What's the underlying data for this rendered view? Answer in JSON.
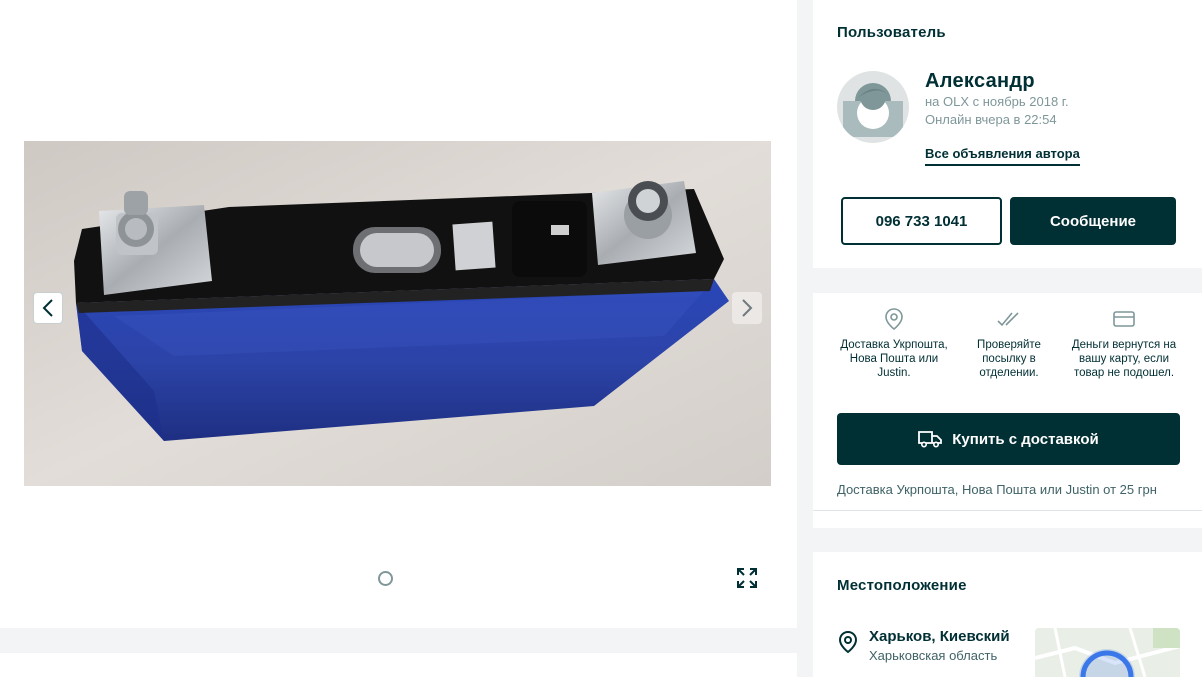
{
  "gallery": {
    "image_alt": "LiFePO4 battery cell",
    "slide_count": 1
  },
  "user": {
    "heading": "Пользователь",
    "name": "Александр",
    "since": "на OLX с ноябрь 2018 г.",
    "online": "Онлайн вчера в 22:54",
    "all_ads": "Все объявления автора",
    "phone": "096 733 1041",
    "message": "Сообщение"
  },
  "delivery": {
    "features": [
      {
        "icon": "location-pin-icon",
        "text": "Доставка Укрпошта, Нова Пошта или Justin."
      },
      {
        "icon": "double-check-icon",
        "text": "Проверяйте посылку в отделении."
      },
      {
        "icon": "credit-card-icon",
        "text": "Деньги вернутся на вашу карту, если товар не подошел."
      }
    ],
    "buy_label": "Купить с доставкой",
    "note": "Доставка Укрпошта, Нова Пошта или Justin от 25 грн"
  },
  "location": {
    "heading": "Местоположение",
    "city": "Харьков, Киевский",
    "region": "Харьковская область"
  },
  "colors": {
    "primary": "#002f34",
    "muted": "#7f9799",
    "background": "#f2f4f5"
  }
}
